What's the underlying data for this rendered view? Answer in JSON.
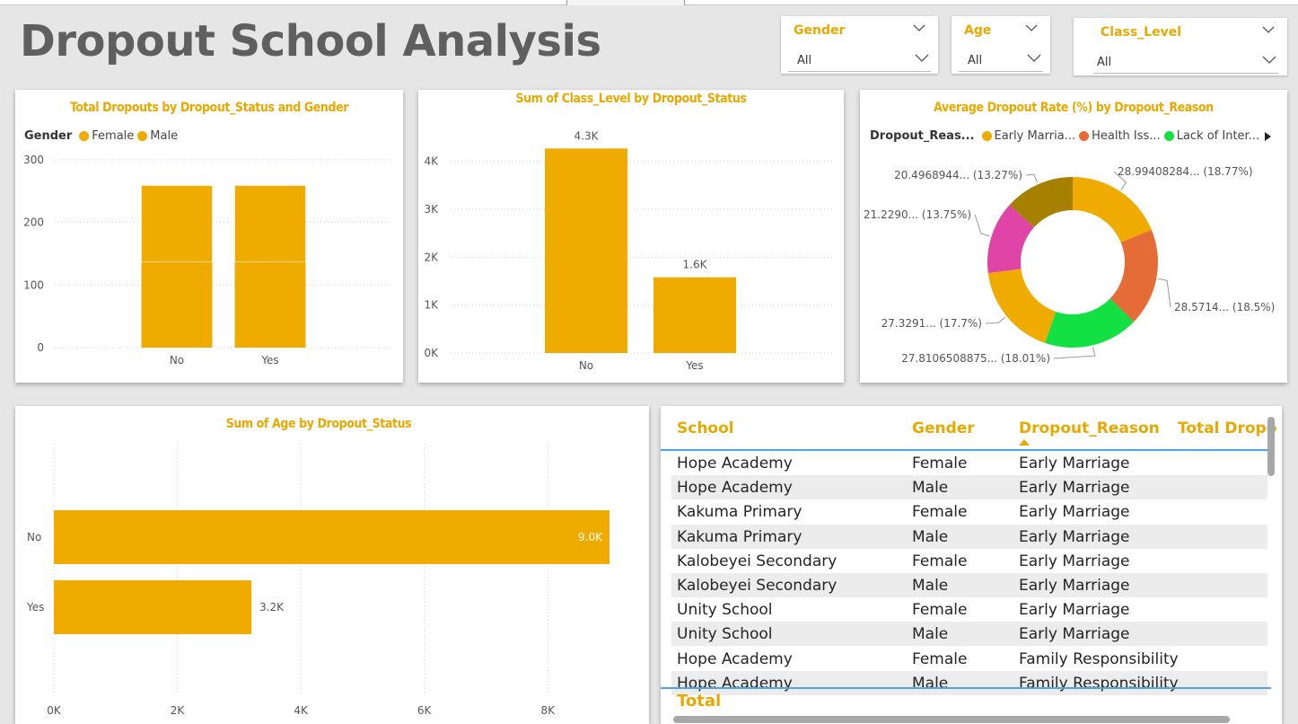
{
  "dashboard": {
    "title": "Dropout School Analysis"
  },
  "slicers": [
    {
      "label": "Gender",
      "value": "All"
    },
    {
      "label": "Age",
      "value": "All"
    },
    {
      "label": "Class_Level",
      "value": "All"
    }
  ],
  "colors": {
    "accent": "#F0AB00",
    "female": "#F0AB00",
    "male": "#F0AB00",
    "table_header": "#E8A800",
    "table_line": "#4FA3E8"
  },
  "chart_data": [
    {
      "type": "bar",
      "title": "Total Dropouts by Dropout_Status and Gender",
      "legend_title": "Gender",
      "legend": [
        "Female",
        "Male"
      ],
      "stacked": true,
      "categories": [
        "No",
        "Yes"
      ],
      "series": [
        {
          "name": "Female",
          "values": [
            137,
            137
          ]
        },
        {
          "name": "Male",
          "values": [
            122,
            122
          ]
        }
      ],
      "y_ticks": [
        "0",
        "100",
        "200",
        "300"
      ],
      "ylim": [
        0,
        300
      ],
      "grid": true
    },
    {
      "type": "bar",
      "title": "Sum of Class_Level by Dropout_Status",
      "categories": [
        "No",
        "Yes"
      ],
      "values": [
        4270,
        1580
      ],
      "data_labels": [
        "4.3K",
        "1.6K"
      ],
      "y_ticks": [
        "0K",
        "1K",
        "2K",
        "3K",
        "4K"
      ],
      "ylim": [
        0,
        4500
      ],
      "grid": true
    },
    {
      "type": "pie",
      "title": "Average Dropout Rate (%) by Dropout_Reason",
      "legend_title": "Dropout_Reas...",
      "legend": [
        "Early Marria...",
        "Health Iss...",
        "Lack of Inter..."
      ],
      "donut": true,
      "slices": [
        {
          "value": 28.99408284,
          "percent": 18.77,
          "color": "#F0AB00",
          "label": "28.99408284... (18.77%)"
        },
        {
          "value": 28.5714,
          "percent": 18.5,
          "color": "#E66C37",
          "label": "28.5714... (18.5%)"
        },
        {
          "value": 27.8106508875,
          "percent": 18.01,
          "color": "#13E042",
          "label": "27.8106508875... (18.01%)"
        },
        {
          "value": 27.3291,
          "percent": 17.7,
          "color": "#F0AB00",
          "label": "27.3291... (17.7%)"
        },
        {
          "value": 21.229,
          "percent": 13.75,
          "color": "#E044A7",
          "label": "21.2290... (13.75%)"
        },
        {
          "value": 20.4968944,
          "percent": 13.27,
          "color": "#A68000",
          "label": "20.4968944... (13.27%)"
        }
      ]
    },
    {
      "type": "bar",
      "orientation": "horizontal",
      "title": "Sum of Age by Dropout_Status",
      "categories": [
        "No",
        "Yes"
      ],
      "values": [
        9000,
        3200
      ],
      "data_labels": [
        "9.0K",
        "3.2K"
      ],
      "x_ticks": [
        "0K",
        "2K",
        "4K",
        "6K",
        "8K"
      ],
      "xlim": [
        0,
        9000
      ],
      "grid": true
    }
  ],
  "table": {
    "columns": [
      "School",
      "Gender",
      "Dropout_Reason",
      "Total Dropo"
    ],
    "rows": [
      [
        "Hope Academy",
        "Female",
        "Early Marriage"
      ],
      [
        "Hope Academy",
        "Male",
        "Early Marriage"
      ],
      [
        "Kakuma Primary",
        "Female",
        "Early Marriage"
      ],
      [
        "Kakuma Primary",
        "Male",
        "Early Marriage"
      ],
      [
        "Kalobeyei Secondary",
        "Female",
        "Early Marriage"
      ],
      [
        "Kalobeyei Secondary",
        "Male",
        "Early Marriage"
      ],
      [
        "Unity School",
        "Female",
        "Early Marriage"
      ],
      [
        "Unity School",
        "Male",
        "Early Marriage"
      ],
      [
        "Hope Academy",
        "Female",
        "Family Responsibility"
      ],
      [
        "Hope Academy",
        "Male",
        "Family Responsibility"
      ]
    ],
    "total_label": "Total"
  }
}
